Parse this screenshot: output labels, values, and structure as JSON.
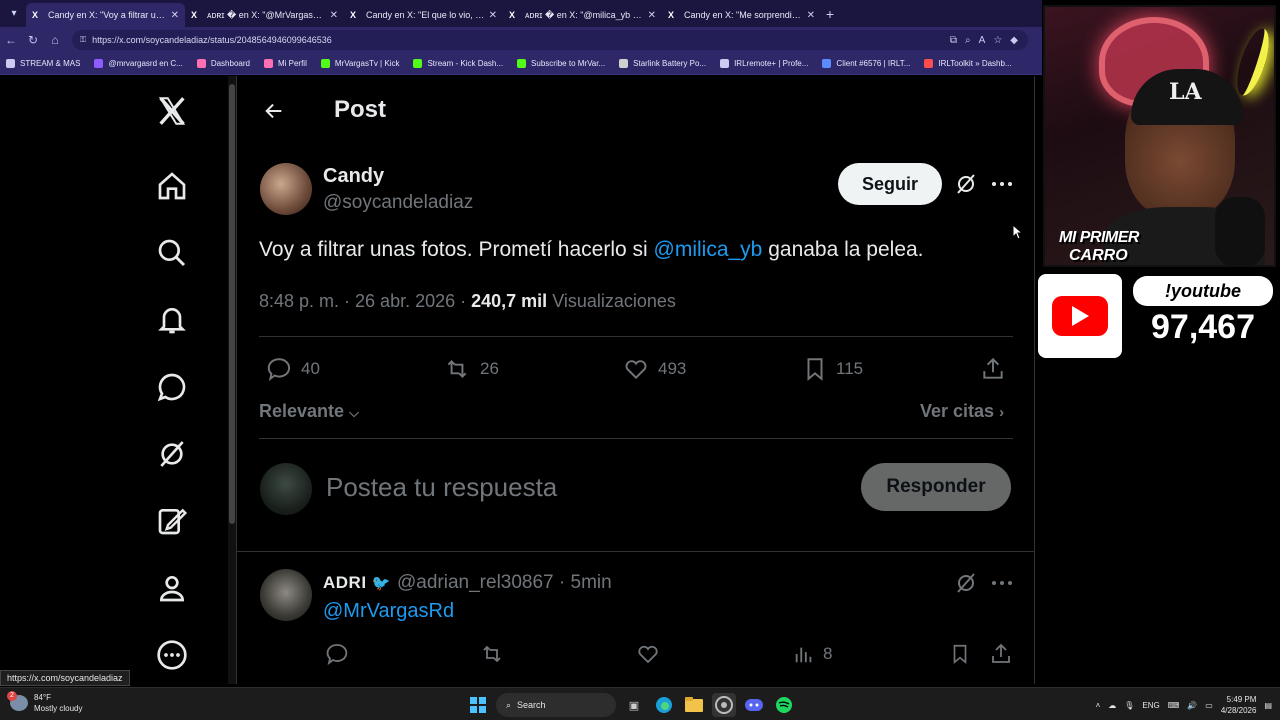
{
  "browser": {
    "tabs": [
      {
        "favicon": "X",
        "title": "Candy en X: \"Voy a filtrar unas fotos",
        "active": true
      },
      {
        "favicon": "X",
        "title": "ᴀᴅʀɪ � en X: \"@MrVargasRd\" / X",
        "active": false
      },
      {
        "favicon": "X",
        "title": "Candy en X: \"El que lo vio, lo vio",
        "active": false
      },
      {
        "favicon": "X",
        "title": "ᴀᴅʀɪ � en X: \"@milica_yb @MrVar",
        "active": false
      },
      {
        "favicon": "X",
        "title": "Candy en X: \"Me sorprendió la rea",
        "active": false
      }
    ],
    "url": "https://x.com/soycandeladiaz/status/2048564946099646536",
    "bookmarks": [
      {
        "label": "STREAM & MAS",
        "color": "#c9cbf0"
      },
      {
        "label": "@mrvargasrd en C...",
        "color": "#8e5cff"
      },
      {
        "label": "Dashboard",
        "color": "#ff6fb1"
      },
      {
        "label": "Mi Perfil",
        "color": "#ff6fb1"
      },
      {
        "label": "MrVargasTv | Kick",
        "color": "#53fc18"
      },
      {
        "label": "Stream - Kick Dash...",
        "color": "#53fc18"
      },
      {
        "label": "Subscribe to MrVar...",
        "color": "#53fc18"
      },
      {
        "label": "Starlink Battery Po...",
        "color": "#d0d0d0"
      },
      {
        "label": "IRLremote+ | Profe...",
        "color": "#c9cbf0"
      },
      {
        "label": "Client #6576 | IRLT...",
        "color": "#5b8cff"
      },
      {
        "label": "IRLToolkit » Dashb...",
        "color": "#ff4d4d"
      }
    ]
  },
  "x": {
    "header_title": "Post",
    "author": {
      "name": "Candy",
      "handle": "@soycandeladiaz"
    },
    "follow_label": "Seguir",
    "tweet": {
      "text_before": "Voy a filtrar unas fotos. Prometí hacerlo si ",
      "mention": "@milica_yb",
      "text_after": " ganaba la pelea."
    },
    "meta": {
      "time": "8:48 p. m. · 26 abr. 2026 · ",
      "views": "240,7 mil",
      "views_label": " Visualizaciones"
    },
    "actions": {
      "replies": "40",
      "reposts": "26",
      "likes": "493",
      "bookmarks": "115"
    },
    "relevante": "Relevante",
    "ver_citas": "Ver citas",
    "reply_placeholder": "Postea tu respuesta",
    "reply_button": "Responder",
    "comment": {
      "name": "ADRI",
      "handle": "@adrian_rel30867 · 5min",
      "mention": "@MrVargasRd",
      "views": "8"
    },
    "status_url": "https://x.com/soycandeladiaz"
  },
  "overlay": {
    "cam_text_1": "MI PRIMER",
    "cam_text_2": "CARRO",
    "cap_logo": "LA",
    "youtube_command": "!youtube",
    "youtube_count": "97,467"
  },
  "taskbar": {
    "weather_temp": "84°F",
    "weather_desc": "Mostly cloudy",
    "weather_badge": "2",
    "search": "Search",
    "lang": "ENG",
    "time": "5:49 PM",
    "date": "4/28/2026"
  }
}
